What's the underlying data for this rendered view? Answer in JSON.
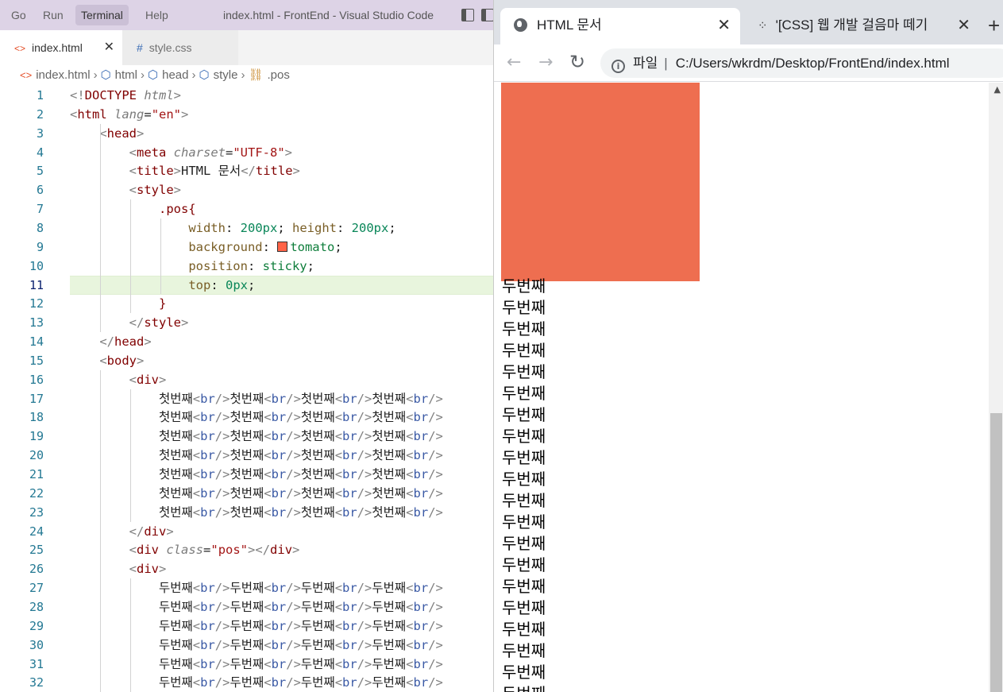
{
  "vscode": {
    "menu": [
      "Go",
      "Run",
      "Terminal",
      "Help"
    ],
    "window_title": "index.html - FrontEnd - Visual Studio Code",
    "tabs": [
      {
        "label": "index.html",
        "icon": "<>",
        "close": "✕"
      },
      {
        "label": "style.css",
        "icon": "#"
      }
    ],
    "breadcrumb": [
      "index.html",
      "html",
      "head",
      "style",
      ".pos"
    ],
    "current_line": 11,
    "lines": [
      [
        [
          "t-br",
          "<!"
        ],
        [
          "t-tag",
          "DOCTYPE"
        ],
        [
          "t-txt",
          " "
        ],
        [
          "t-attr",
          "html"
        ],
        [
          "t-br",
          ">"
        ]
      ],
      [
        [
          "t-br",
          "<"
        ],
        [
          "t-tag",
          "html"
        ],
        [
          "t-txt",
          " "
        ],
        [
          "t-attr",
          "lang"
        ],
        [
          "t-txt",
          "="
        ],
        [
          "t-str",
          "\"en\""
        ],
        [
          "t-br",
          ">"
        ]
      ],
      [
        [
          "t-txt",
          "    "
        ],
        [
          "t-br",
          "<"
        ],
        [
          "t-tag",
          "head"
        ],
        [
          "t-br",
          ">"
        ]
      ],
      [
        [
          "t-txt",
          "        "
        ],
        [
          "t-br",
          "<"
        ],
        [
          "t-tag",
          "meta"
        ],
        [
          "t-txt",
          " "
        ],
        [
          "t-attr",
          "charset"
        ],
        [
          "t-txt",
          "="
        ],
        [
          "t-str",
          "\"UTF-8\""
        ],
        [
          "t-br",
          ">"
        ]
      ],
      [
        [
          "t-txt",
          "        "
        ],
        [
          "t-br",
          "<"
        ],
        [
          "t-tag",
          "title"
        ],
        [
          "t-br",
          ">"
        ],
        [
          "t-txt",
          "HTML 문서"
        ],
        [
          "t-br",
          "</"
        ],
        [
          "t-tag",
          "title"
        ],
        [
          "t-br",
          ">"
        ]
      ],
      [
        [
          "t-txt",
          "        "
        ],
        [
          "t-br",
          "<"
        ],
        [
          "t-tag",
          "style"
        ],
        [
          "t-br",
          ">"
        ]
      ],
      [
        [
          "t-txt",
          "            "
        ],
        [
          "t-sel",
          ".pos{"
        ]
      ],
      [
        [
          "t-txt",
          "                "
        ],
        [
          "t-prop",
          "width"
        ],
        [
          "t-txt",
          ": "
        ],
        [
          "t-num",
          "200px"
        ],
        [
          "t-txt",
          "; "
        ],
        [
          "t-prop",
          "height"
        ],
        [
          "t-txt",
          ": "
        ],
        [
          "t-num",
          "200px"
        ],
        [
          "t-txt",
          ";"
        ]
      ],
      [
        [
          "t-txt",
          "                "
        ],
        [
          "t-prop",
          "background"
        ],
        [
          "t-txt",
          ": "
        ],
        [
          "swatch",
          ""
        ],
        [
          "t-val",
          "tomato"
        ],
        [
          "t-txt",
          ";"
        ]
      ],
      [
        [
          "t-txt",
          "                "
        ],
        [
          "t-prop",
          "position"
        ],
        [
          "t-txt",
          ": "
        ],
        [
          "t-val",
          "sticky"
        ],
        [
          "t-txt",
          ";"
        ]
      ],
      [
        [
          "t-txt",
          "                "
        ],
        [
          "t-prop",
          "top"
        ],
        [
          "t-txt",
          ": "
        ],
        [
          "t-num",
          "0px"
        ],
        [
          "t-txt",
          ";"
        ]
      ],
      [
        [
          "t-txt",
          "            "
        ],
        [
          "t-sel",
          "}"
        ]
      ],
      [
        [
          "t-txt",
          "        "
        ],
        [
          "t-br",
          "</"
        ],
        [
          "t-tag",
          "style"
        ],
        [
          "t-br",
          ">"
        ]
      ],
      [
        [
          "t-txt",
          "    "
        ],
        [
          "t-br",
          "</"
        ],
        [
          "t-tag",
          "head"
        ],
        [
          "t-br",
          ">"
        ]
      ],
      [
        [
          "t-txt",
          "    "
        ],
        [
          "t-br",
          "<"
        ],
        [
          "t-tag",
          "body"
        ],
        [
          "t-br",
          ">"
        ]
      ],
      [
        [
          "t-txt",
          "        "
        ],
        [
          "t-br",
          "<"
        ],
        [
          "t-tag",
          "div"
        ],
        [
          "t-br",
          ">"
        ]
      ],
      [
        [
          "t-txt",
          "            첫번째"
        ],
        [
          "t-br",
          "<"
        ],
        [
          "t-tagb",
          "br"
        ],
        [
          "t-br",
          "/>"
        ],
        [
          "t-txt",
          "첫번째"
        ],
        [
          "t-br",
          "<"
        ],
        [
          "t-tagb",
          "br"
        ],
        [
          "t-br",
          "/>"
        ],
        [
          "t-txt",
          "첫번째"
        ],
        [
          "t-br",
          "<"
        ],
        [
          "t-tagb",
          "br"
        ],
        [
          "t-br",
          "/>"
        ],
        [
          "t-txt",
          "첫번째"
        ],
        [
          "t-br",
          "<"
        ],
        [
          "t-tagb",
          "br"
        ],
        [
          "t-br",
          "/>"
        ]
      ],
      [
        [
          "t-txt",
          "            첫번째"
        ],
        [
          "t-br",
          "<"
        ],
        [
          "t-tagb",
          "br"
        ],
        [
          "t-br",
          "/>"
        ],
        [
          "t-txt",
          "첫번째"
        ],
        [
          "t-br",
          "<"
        ],
        [
          "t-tagb",
          "br"
        ],
        [
          "t-br",
          "/>"
        ],
        [
          "t-txt",
          "첫번째"
        ],
        [
          "t-br",
          "<"
        ],
        [
          "t-tagb",
          "br"
        ],
        [
          "t-br",
          "/>"
        ],
        [
          "t-txt",
          "첫번째"
        ],
        [
          "t-br",
          "<"
        ],
        [
          "t-tagb",
          "br"
        ],
        [
          "t-br",
          "/>"
        ]
      ],
      [
        [
          "t-txt",
          "            첫번째"
        ],
        [
          "t-br",
          "<"
        ],
        [
          "t-tagb",
          "br"
        ],
        [
          "t-br",
          "/>"
        ],
        [
          "t-txt",
          "첫번째"
        ],
        [
          "t-br",
          "<"
        ],
        [
          "t-tagb",
          "br"
        ],
        [
          "t-br",
          "/>"
        ],
        [
          "t-txt",
          "첫번째"
        ],
        [
          "t-br",
          "<"
        ],
        [
          "t-tagb",
          "br"
        ],
        [
          "t-br",
          "/>"
        ],
        [
          "t-txt",
          "첫번째"
        ],
        [
          "t-br",
          "<"
        ],
        [
          "t-tagb",
          "br"
        ],
        [
          "t-br",
          "/>"
        ]
      ],
      [
        [
          "t-txt",
          "            첫번째"
        ],
        [
          "t-br",
          "<"
        ],
        [
          "t-tagb",
          "br"
        ],
        [
          "t-br",
          "/>"
        ],
        [
          "t-txt",
          "첫번째"
        ],
        [
          "t-br",
          "<"
        ],
        [
          "t-tagb",
          "br"
        ],
        [
          "t-br",
          "/>"
        ],
        [
          "t-txt",
          "첫번째"
        ],
        [
          "t-br",
          "<"
        ],
        [
          "t-tagb",
          "br"
        ],
        [
          "t-br",
          "/>"
        ],
        [
          "t-txt",
          "첫번째"
        ],
        [
          "t-br",
          "<"
        ],
        [
          "t-tagb",
          "br"
        ],
        [
          "t-br",
          "/>"
        ]
      ],
      [
        [
          "t-txt",
          "            첫번째"
        ],
        [
          "t-br",
          "<"
        ],
        [
          "t-tagb",
          "br"
        ],
        [
          "t-br",
          "/>"
        ],
        [
          "t-txt",
          "첫번째"
        ],
        [
          "t-br",
          "<"
        ],
        [
          "t-tagb",
          "br"
        ],
        [
          "t-br",
          "/>"
        ],
        [
          "t-txt",
          "첫번째"
        ],
        [
          "t-br",
          "<"
        ],
        [
          "t-tagb",
          "br"
        ],
        [
          "t-br",
          "/>"
        ],
        [
          "t-txt",
          "첫번째"
        ],
        [
          "t-br",
          "<"
        ],
        [
          "t-tagb",
          "br"
        ],
        [
          "t-br",
          "/>"
        ]
      ],
      [
        [
          "t-txt",
          "            첫번째"
        ],
        [
          "t-br",
          "<"
        ],
        [
          "t-tagb",
          "br"
        ],
        [
          "t-br",
          "/>"
        ],
        [
          "t-txt",
          "첫번째"
        ],
        [
          "t-br",
          "<"
        ],
        [
          "t-tagb",
          "br"
        ],
        [
          "t-br",
          "/>"
        ],
        [
          "t-txt",
          "첫번째"
        ],
        [
          "t-br",
          "<"
        ],
        [
          "t-tagb",
          "br"
        ],
        [
          "t-br",
          "/>"
        ],
        [
          "t-txt",
          "첫번째"
        ],
        [
          "t-br",
          "<"
        ],
        [
          "t-tagb",
          "br"
        ],
        [
          "t-br",
          "/>"
        ]
      ],
      [
        [
          "t-txt",
          "            첫번째"
        ],
        [
          "t-br",
          "<"
        ],
        [
          "t-tagb",
          "br"
        ],
        [
          "t-br",
          "/>"
        ],
        [
          "t-txt",
          "첫번째"
        ],
        [
          "t-br",
          "<"
        ],
        [
          "t-tagb",
          "br"
        ],
        [
          "t-br",
          "/>"
        ],
        [
          "t-txt",
          "첫번째"
        ],
        [
          "t-br",
          "<"
        ],
        [
          "t-tagb",
          "br"
        ],
        [
          "t-br",
          "/>"
        ],
        [
          "t-txt",
          "첫번째"
        ],
        [
          "t-br",
          "<"
        ],
        [
          "t-tagb",
          "br"
        ],
        [
          "t-br",
          "/>"
        ]
      ],
      [
        [
          "t-txt",
          "        "
        ],
        [
          "t-br",
          "</"
        ],
        [
          "t-tag",
          "div"
        ],
        [
          "t-br",
          ">"
        ]
      ],
      [
        [
          "t-txt",
          "        "
        ],
        [
          "t-br",
          "<"
        ],
        [
          "t-tag",
          "div"
        ],
        [
          "t-txt",
          " "
        ],
        [
          "t-attr",
          "class"
        ],
        [
          "t-txt",
          "="
        ],
        [
          "t-str",
          "\"pos\""
        ],
        [
          "t-br",
          "></"
        ],
        [
          "t-tag",
          "div"
        ],
        [
          "t-br",
          ">"
        ]
      ],
      [
        [
          "t-txt",
          "        "
        ],
        [
          "t-br",
          "<"
        ],
        [
          "t-tag",
          "div"
        ],
        [
          "t-br",
          ">"
        ]
      ],
      [
        [
          "t-txt",
          "            두번째"
        ],
        [
          "t-br",
          "<"
        ],
        [
          "t-tagb",
          "br"
        ],
        [
          "t-br",
          "/>"
        ],
        [
          "t-txt",
          "두번째"
        ],
        [
          "t-br",
          "<"
        ],
        [
          "t-tagb",
          "br"
        ],
        [
          "t-br",
          "/>"
        ],
        [
          "t-txt",
          "두번째"
        ],
        [
          "t-br",
          "<"
        ],
        [
          "t-tagb",
          "br"
        ],
        [
          "t-br",
          "/>"
        ],
        [
          "t-txt",
          "두번째"
        ],
        [
          "t-br",
          "<"
        ],
        [
          "t-tagb",
          "br"
        ],
        [
          "t-br",
          "/>"
        ]
      ],
      [
        [
          "t-txt",
          "            두번째"
        ],
        [
          "t-br",
          "<"
        ],
        [
          "t-tagb",
          "br"
        ],
        [
          "t-br",
          "/>"
        ],
        [
          "t-txt",
          "두번째"
        ],
        [
          "t-br",
          "<"
        ],
        [
          "t-tagb",
          "br"
        ],
        [
          "t-br",
          "/>"
        ],
        [
          "t-txt",
          "두번째"
        ],
        [
          "t-br",
          "<"
        ],
        [
          "t-tagb",
          "br"
        ],
        [
          "t-br",
          "/>"
        ],
        [
          "t-txt",
          "두번째"
        ],
        [
          "t-br",
          "<"
        ],
        [
          "t-tagb",
          "br"
        ],
        [
          "t-br",
          "/>"
        ]
      ],
      [
        [
          "t-txt",
          "            두번째"
        ],
        [
          "t-br",
          "<"
        ],
        [
          "t-tagb",
          "br"
        ],
        [
          "t-br",
          "/>"
        ],
        [
          "t-txt",
          "두번째"
        ],
        [
          "t-br",
          "<"
        ],
        [
          "t-tagb",
          "br"
        ],
        [
          "t-br",
          "/>"
        ],
        [
          "t-txt",
          "두번째"
        ],
        [
          "t-br",
          "<"
        ],
        [
          "t-tagb",
          "br"
        ],
        [
          "t-br",
          "/>"
        ],
        [
          "t-txt",
          "두번째"
        ],
        [
          "t-br",
          "<"
        ],
        [
          "t-tagb",
          "br"
        ],
        [
          "t-br",
          "/>"
        ]
      ],
      [
        [
          "t-txt",
          "            두번째"
        ],
        [
          "t-br",
          "<"
        ],
        [
          "t-tagb",
          "br"
        ],
        [
          "t-br",
          "/>"
        ],
        [
          "t-txt",
          "두번째"
        ],
        [
          "t-br",
          "<"
        ],
        [
          "t-tagb",
          "br"
        ],
        [
          "t-br",
          "/>"
        ],
        [
          "t-txt",
          "두번째"
        ],
        [
          "t-br",
          "<"
        ],
        [
          "t-tagb",
          "br"
        ],
        [
          "t-br",
          "/>"
        ],
        [
          "t-txt",
          "두번째"
        ],
        [
          "t-br",
          "<"
        ],
        [
          "t-tagb",
          "br"
        ],
        [
          "t-br",
          "/>"
        ]
      ],
      [
        [
          "t-txt",
          "            두번째"
        ],
        [
          "t-br",
          "<"
        ],
        [
          "t-tagb",
          "br"
        ],
        [
          "t-br",
          "/>"
        ],
        [
          "t-txt",
          "두번째"
        ],
        [
          "t-br",
          "<"
        ],
        [
          "t-tagb",
          "br"
        ],
        [
          "t-br",
          "/>"
        ],
        [
          "t-txt",
          "두번째"
        ],
        [
          "t-br",
          "<"
        ],
        [
          "t-tagb",
          "br"
        ],
        [
          "t-br",
          "/>"
        ],
        [
          "t-txt",
          "두번째"
        ],
        [
          "t-br",
          "<"
        ],
        [
          "t-tagb",
          "br"
        ],
        [
          "t-br",
          "/>"
        ]
      ],
      [
        [
          "t-txt",
          "            두번째"
        ],
        [
          "t-br",
          "<"
        ],
        [
          "t-tagb",
          "br"
        ],
        [
          "t-br",
          "/>"
        ],
        [
          "t-txt",
          "두번째"
        ],
        [
          "t-br",
          "<"
        ],
        [
          "t-tagb",
          "br"
        ],
        [
          "t-br",
          "/>"
        ],
        [
          "t-txt",
          "두번째"
        ],
        [
          "t-br",
          "<"
        ],
        [
          "t-tagb",
          "br"
        ],
        [
          "t-br",
          "/>"
        ],
        [
          "t-txt",
          "두번째"
        ],
        [
          "t-br",
          "<"
        ],
        [
          "t-tagb",
          "br"
        ],
        [
          "t-br",
          "/>"
        ]
      ]
    ]
  },
  "browser": {
    "tabs": [
      {
        "label": "HTML 문서",
        "close": "✕"
      },
      {
        "label": "'[CSS] 웹 개발 걸음마 떼기",
        "close": "✕"
      }
    ],
    "new_tab": "+",
    "nav_back": "←",
    "nav_forward": "→",
    "nav_reload": "↻",
    "address_scheme": "파일",
    "address_sep": "|",
    "address_url": "C:/Users/wkrdm/Desktop/FrontEnd/index.html",
    "page": {
      "pos_color": "#ee6e50",
      "repeated_text": "두번째",
      "repeated_count": 20
    }
  }
}
